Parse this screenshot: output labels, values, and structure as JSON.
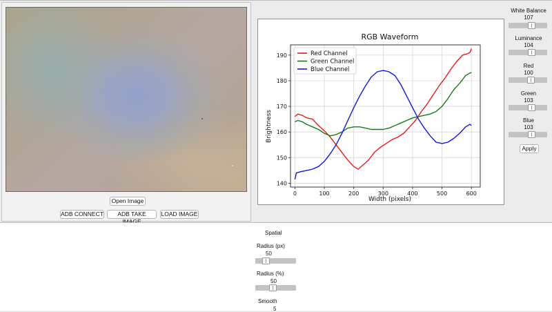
{
  "image_panel": {
    "open_image_label": "Open Image",
    "adb_connect_label": "ADB CONNECT",
    "adb_take_image_label": "ADB TAKE IMAGE",
    "load_image_label": "LOAD IMAGE"
  },
  "controls": {
    "white_balance": {
      "label": "White Balance",
      "value": "107"
    },
    "luminance": {
      "label": "Luminance",
      "value": "104"
    },
    "red": {
      "label": "Red",
      "value": "100"
    },
    "green": {
      "label": "Green",
      "value": "103"
    },
    "blue": {
      "label": "Blue",
      "value": "103"
    },
    "apply_label": "Apply"
  },
  "spatial": {
    "title": "Spatial",
    "radius_px": {
      "label": "Radius (px)",
      "value": "50"
    },
    "radius_pct": {
      "label": "Radius (%)",
      "value": "50"
    },
    "smooth": {
      "label": "Smooth",
      "value": "5"
    }
  },
  "colors": {
    "red": "#e8191b",
    "green": "#137a13",
    "blue": "#1313e8"
  },
  "chart_data": {
    "type": "line",
    "title": "RGB Waveform",
    "xlabel": "Width (pixels)",
    "ylabel": "Brightness",
    "xlim": [
      -15,
      630
    ],
    "ylim": [
      138.5,
      194
    ],
    "xticks": [
      0,
      100,
      200,
      300,
      400,
      500,
      600
    ],
    "yticks": [
      140,
      150,
      160,
      170,
      180,
      190
    ],
    "grid": true,
    "legend": "top-left",
    "series": [
      {
        "name": "Red Channel",
        "color": "#e8191b",
        "x": [
          0,
          10,
          25,
          40,
          60,
          80,
          100,
          120,
          140,
          160,
          180,
          200,
          215,
          230,
          250,
          270,
          290,
          310,
          330,
          350,
          370,
          390,
          410,
          430,
          450,
          470,
          490,
          510,
          530,
          550,
          570,
          585,
          595,
          600
        ],
        "values": [
          166,
          167,
          166.5,
          165.5,
          165,
          162.5,
          160.5,
          158,
          155,
          152,
          149,
          146.5,
          145.5,
          147,
          149,
          152,
          154,
          155.5,
          157,
          158,
          159.5,
          162,
          164.5,
          168,
          171,
          174.5,
          178,
          181,
          184.5,
          187.5,
          190,
          190.5,
          191,
          192.5
        ]
      },
      {
        "name": "Green Channel",
        "color": "#137a13",
        "x": [
          0,
          10,
          25,
          40,
          60,
          80,
          100,
          120,
          140,
          160,
          180,
          200,
          220,
          240,
          260,
          280,
          300,
          320,
          340,
          360,
          380,
          400,
          420,
          440,
          460,
          480,
          500,
          520,
          540,
          560,
          580,
          595,
          600
        ],
        "values": [
          164,
          164.5,
          164,
          163,
          162,
          161,
          159.5,
          158.5,
          159,
          160,
          161.5,
          162,
          162,
          161.5,
          161,
          161,
          161,
          161.5,
          162.5,
          163.5,
          164.5,
          165.5,
          166,
          166.5,
          167,
          168,
          170,
          173,
          176.5,
          179,
          182,
          183,
          183.2
        ]
      },
      {
        "name": "Blue Channel",
        "color": "#1313e8",
        "x": [
          0,
          5,
          20,
          40,
          60,
          80,
          100,
          120,
          140,
          160,
          180,
          200,
          220,
          240,
          260,
          280,
          300,
          320,
          340,
          360,
          380,
          400,
          420,
          440,
          460,
          480,
          500,
          520,
          540,
          560,
          580,
          595,
          600
        ],
        "values": [
          141.5,
          144,
          144.5,
          145,
          145.5,
          146.5,
          148.5,
          151.5,
          155,
          159.5,
          164.5,
          169.5,
          174,
          178,
          181.5,
          183.5,
          184,
          183.5,
          182,
          178.5,
          174,
          169.5,
          165,
          161.5,
          158.5,
          156,
          155.5,
          156,
          157.5,
          159.5,
          162,
          163,
          162.5
        ]
      }
    ]
  }
}
